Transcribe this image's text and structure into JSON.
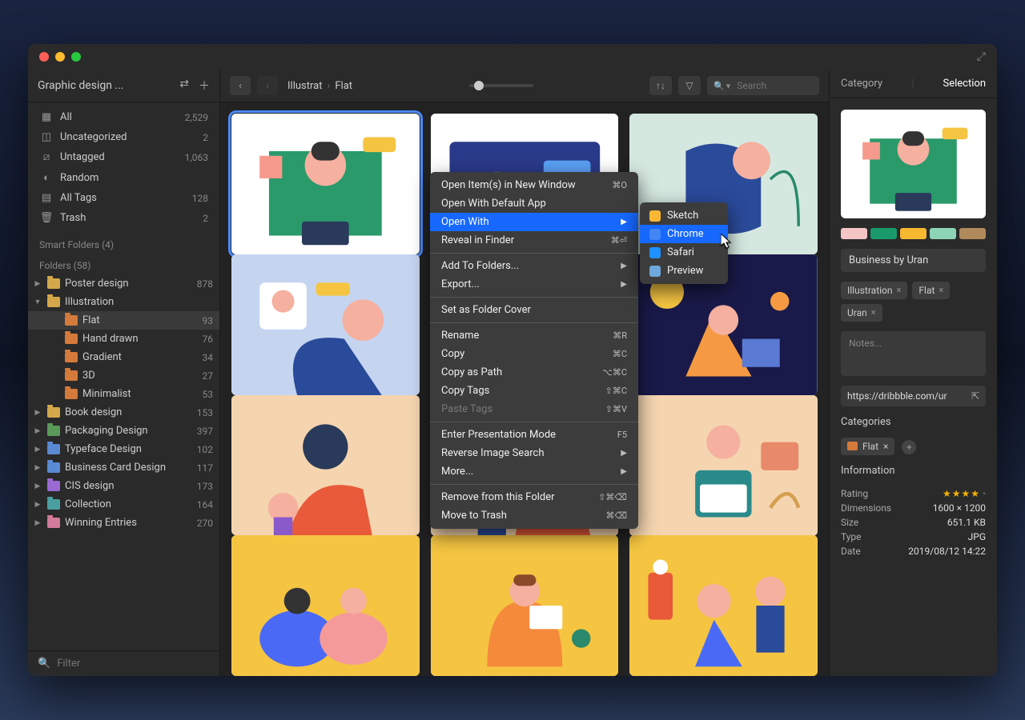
{
  "sidebar": {
    "title": "Graphic design ...",
    "library": [
      {
        "icon": "grid",
        "label": "All",
        "count": "2,529"
      },
      {
        "icon": "uncategorized",
        "label": "Uncategorized",
        "count": "2"
      },
      {
        "icon": "untagged",
        "label": "Untagged",
        "count": "1,063"
      },
      {
        "icon": "random",
        "label": "Random",
        "count": ""
      },
      {
        "icon": "tags",
        "label": "All Tags",
        "count": "128"
      },
      {
        "icon": "trash",
        "label": "Trash",
        "count": "2"
      }
    ],
    "smart_label": "Smart Folders (4)",
    "folders_label": "Folders (58)",
    "folders": [
      {
        "label": "Poster design",
        "count": "878",
        "color": "yellow",
        "chev": "▶"
      },
      {
        "label": "Illustration",
        "count": "",
        "color": "yellow",
        "chev": "▼",
        "expanded": true,
        "children": [
          {
            "label": "Flat",
            "count": "93",
            "color": "orange",
            "active": true
          },
          {
            "label": "Hand drawn",
            "count": "76",
            "color": "orange"
          },
          {
            "label": "Gradient",
            "count": "34",
            "color": "orange"
          },
          {
            "label": "3D",
            "count": "27",
            "color": "orange"
          },
          {
            "label": "Minimalist",
            "count": "53",
            "color": "orange"
          }
        ]
      },
      {
        "label": "Book design",
        "count": "153",
        "color": "yellow",
        "chev": "▶"
      },
      {
        "label": "Packaging Design",
        "count": "397",
        "color": "green",
        "chev": "▶"
      },
      {
        "label": "Typeface Design",
        "count": "102",
        "color": "blue",
        "chev": "▶"
      },
      {
        "label": "Business Card Design",
        "count": "117",
        "color": "blue",
        "chev": "▶"
      },
      {
        "label": "CIS design",
        "count": "173",
        "color": "purple",
        "chev": "▶"
      },
      {
        "label": "Collection",
        "count": "164",
        "color": "teal",
        "chev": "▶"
      },
      {
        "label": "Winning Entries",
        "count": "270",
        "color": "pink",
        "chev": "▶"
      }
    ],
    "filter_placeholder": "Filter"
  },
  "toolbar": {
    "breadcrumb": [
      "Illustrat",
      "Flat"
    ],
    "search_placeholder": "Search"
  },
  "context_menu": {
    "items": [
      {
        "label": "Open Item(s) in New Window",
        "shortcut": "⌘O"
      },
      {
        "label": "Open With Default App"
      },
      {
        "label": "Open With",
        "submenu": true,
        "highlight": true
      },
      {
        "label": "Reveal in Finder",
        "shortcut": "⌘⏎"
      },
      {
        "sep": true
      },
      {
        "label": "Add To Folders...",
        "submenu": true
      },
      {
        "label": "Export...",
        "submenu": true
      },
      {
        "sep": true
      },
      {
        "label": "Set as Folder Cover"
      },
      {
        "sep": true
      },
      {
        "label": "Rename",
        "shortcut": "⌘R"
      },
      {
        "label": "Copy",
        "shortcut": "⌘C"
      },
      {
        "label": "Copy as Path",
        "shortcut": "⌥⌘C"
      },
      {
        "label": "Copy Tags",
        "shortcut": "⇧⌘C"
      },
      {
        "label": "Paste Tags",
        "shortcut": "⇧⌘V",
        "disabled": true
      },
      {
        "sep": true
      },
      {
        "label": "Enter Presentation Mode",
        "shortcut": "F5"
      },
      {
        "label": "Reverse Image Search",
        "submenu": true
      },
      {
        "label": "More...",
        "submenu": true
      },
      {
        "sep": true
      },
      {
        "label": "Remove from this Folder",
        "shortcut": "⇧⌘⌫"
      },
      {
        "label": "Move to Trash",
        "shortcut": "⌘⌫"
      }
    ],
    "submenu": [
      {
        "label": "Sketch",
        "color": "#f7b733"
      },
      {
        "label": "Chrome",
        "color": "#4285f4",
        "highlight": true
      },
      {
        "label": "Safari",
        "color": "#1e90ff"
      },
      {
        "label": "Preview",
        "color": "#6fa8dc"
      }
    ]
  },
  "inspector": {
    "tabs": [
      "Category",
      "Selection"
    ],
    "swatches": [
      "#f5c5c5",
      "#1a9a6b",
      "#f5b82e",
      "#8cd4b5",
      "#b08a5a"
    ],
    "title": "Business by Uran",
    "tags": [
      "Illustration",
      "Flat",
      "Uran"
    ],
    "notes_placeholder": "Notes...",
    "url": "https://dribbble.com/ur",
    "categories_label": "Categories",
    "category_chip": "Flat",
    "info_label": "Information",
    "info": [
      {
        "k": "Rating",
        "v": "★★★★",
        "extra": "· "
      },
      {
        "k": "Dimensions",
        "v": "1600 × 1200"
      },
      {
        "k": "Size",
        "v": "651.1 KB"
      },
      {
        "k": "Type",
        "v": "JPG"
      },
      {
        "k": "Date",
        "v": "2019/08/12 14:22"
      }
    ]
  }
}
